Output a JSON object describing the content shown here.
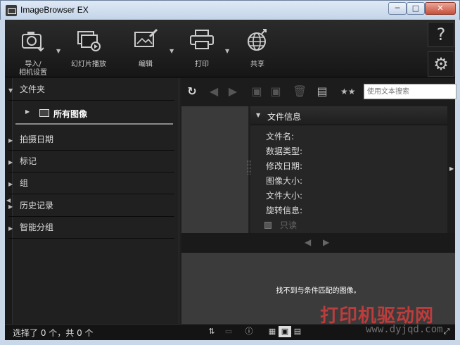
{
  "window": {
    "title": "ImageBrowser EX",
    "min_glyph": "─",
    "max_glyph": "□",
    "close_glyph": "✕"
  },
  "toolbar": {
    "import_label_line1": "导入/",
    "import_label_line2": "相机设置",
    "slideshow_label": "幻灯片播放",
    "edit_label": "编辑",
    "print_label": "打印",
    "share_label": "共享",
    "help_glyph": "?",
    "settings_glyph": "⚙"
  },
  "left_panel": {
    "folders_header": "文件夹",
    "all_images": "所有图像",
    "items": [
      "拍摄日期",
      "标记",
      "组",
      "历史记录",
      "智能分组"
    ]
  },
  "search": {
    "placeholder": "使用文本搜索"
  },
  "file_info": {
    "header": "文件信息",
    "fields": [
      "文件名:",
      "数据类型:",
      "修改日期:",
      "图像大小:",
      "文件大小:",
      "旋转信息:"
    ],
    "readonly_label": "只读"
  },
  "preview": {
    "no_match_text": "找不到与条件匹配的图像。"
  },
  "status": {
    "selection_text": "选择了 0 个，共 0 个"
  },
  "watermark": {
    "text": "打印机驱动网",
    "url": "www.dyjqd.com"
  },
  "colors": {
    "background": "#1e1e1e",
    "titlebar": "#c9d7e8",
    "accent_close": "#c7503a"
  }
}
